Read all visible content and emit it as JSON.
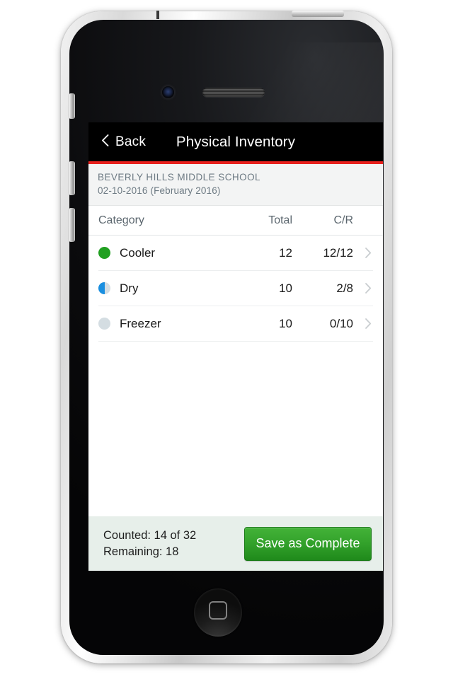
{
  "device": {
    "name": "iphone-4",
    "icons": {
      "front_camera": "camera-icon",
      "earpiece": "speaker-grille-icon",
      "home_button": "home-button-icon",
      "mute_switch": "mute-switch",
      "volume_up": "volume-up-button",
      "volume_down": "volume-down-button",
      "power": "power-button"
    }
  },
  "navbar": {
    "back_label": "Back",
    "back_icon": "chevron-left-icon",
    "title": "Physical Inventory",
    "background": "#000000",
    "accent_color": "#e8201c"
  },
  "subheader": {
    "school": "BEVERLY HILLS MIDDLE SCHOOL",
    "date": "02-10-2016 (February 2016)"
  },
  "table": {
    "columns": {
      "category": "Category",
      "total": "Total",
      "cr": "C/R"
    },
    "rows": [
      {
        "status": "full",
        "status_color": "#21a021",
        "category": "Cooler",
        "total": "12",
        "cr": "12/12",
        "chevron": "chevron-right-icon"
      },
      {
        "status": "half",
        "status_color": "#1a8fe0",
        "category": "Dry",
        "total": "10",
        "cr": "2/8",
        "chevron": "chevron-right-icon"
      },
      {
        "status": "empty",
        "status_color": "#d4dde2",
        "category": "Freezer",
        "total": "10",
        "cr": "0/10",
        "chevron": "chevron-right-icon"
      }
    ]
  },
  "footer": {
    "counted": "Counted: 14 of 32",
    "remaining": "Remaining: 18",
    "save_label": "Save as Complete",
    "save_color": "#2ea329",
    "background": "#e7efea"
  }
}
